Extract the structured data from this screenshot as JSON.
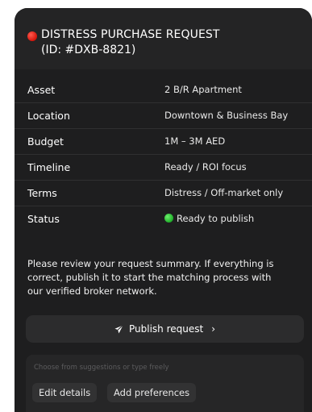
{
  "header": {
    "title": "DISTRESS PURCHASE REQUEST",
    "request_id": "(ID: #DXB-8821)"
  },
  "summary_rows": [
    {
      "label": "Asset",
      "value": "2 B/R Apartment"
    },
    {
      "label": "Location",
      "value": "Downtown & Business Bay"
    },
    {
      "label": "Budget",
      "value": "1M – 3M AED"
    },
    {
      "label": "Timeline",
      "value": "Ready / ROI focus"
    },
    {
      "label": "Terms",
      "value": "Distress / Off-market only"
    },
    {
      "label": "Status",
      "value": "Ready to publish"
    }
  ],
  "message": "Please review your request summary. If everything is correct, publish it to start the matching process with our verified broker network.",
  "publish_button": {
    "label": "Publish request",
    "chevron": "›"
  },
  "suggestions": {
    "placeholder": "Choose from suggestions or type freely",
    "chips": [
      "Edit details",
      "Add preferences"
    ]
  },
  "icons": {
    "header_indicator": "red-dot-icon",
    "status_indicator": "green-dot-icon",
    "publish": "send-icon"
  },
  "colors": {
    "card_background": "#1e1e1f",
    "header_indicator": "#e0241b",
    "status_ready": "#2ec537"
  }
}
